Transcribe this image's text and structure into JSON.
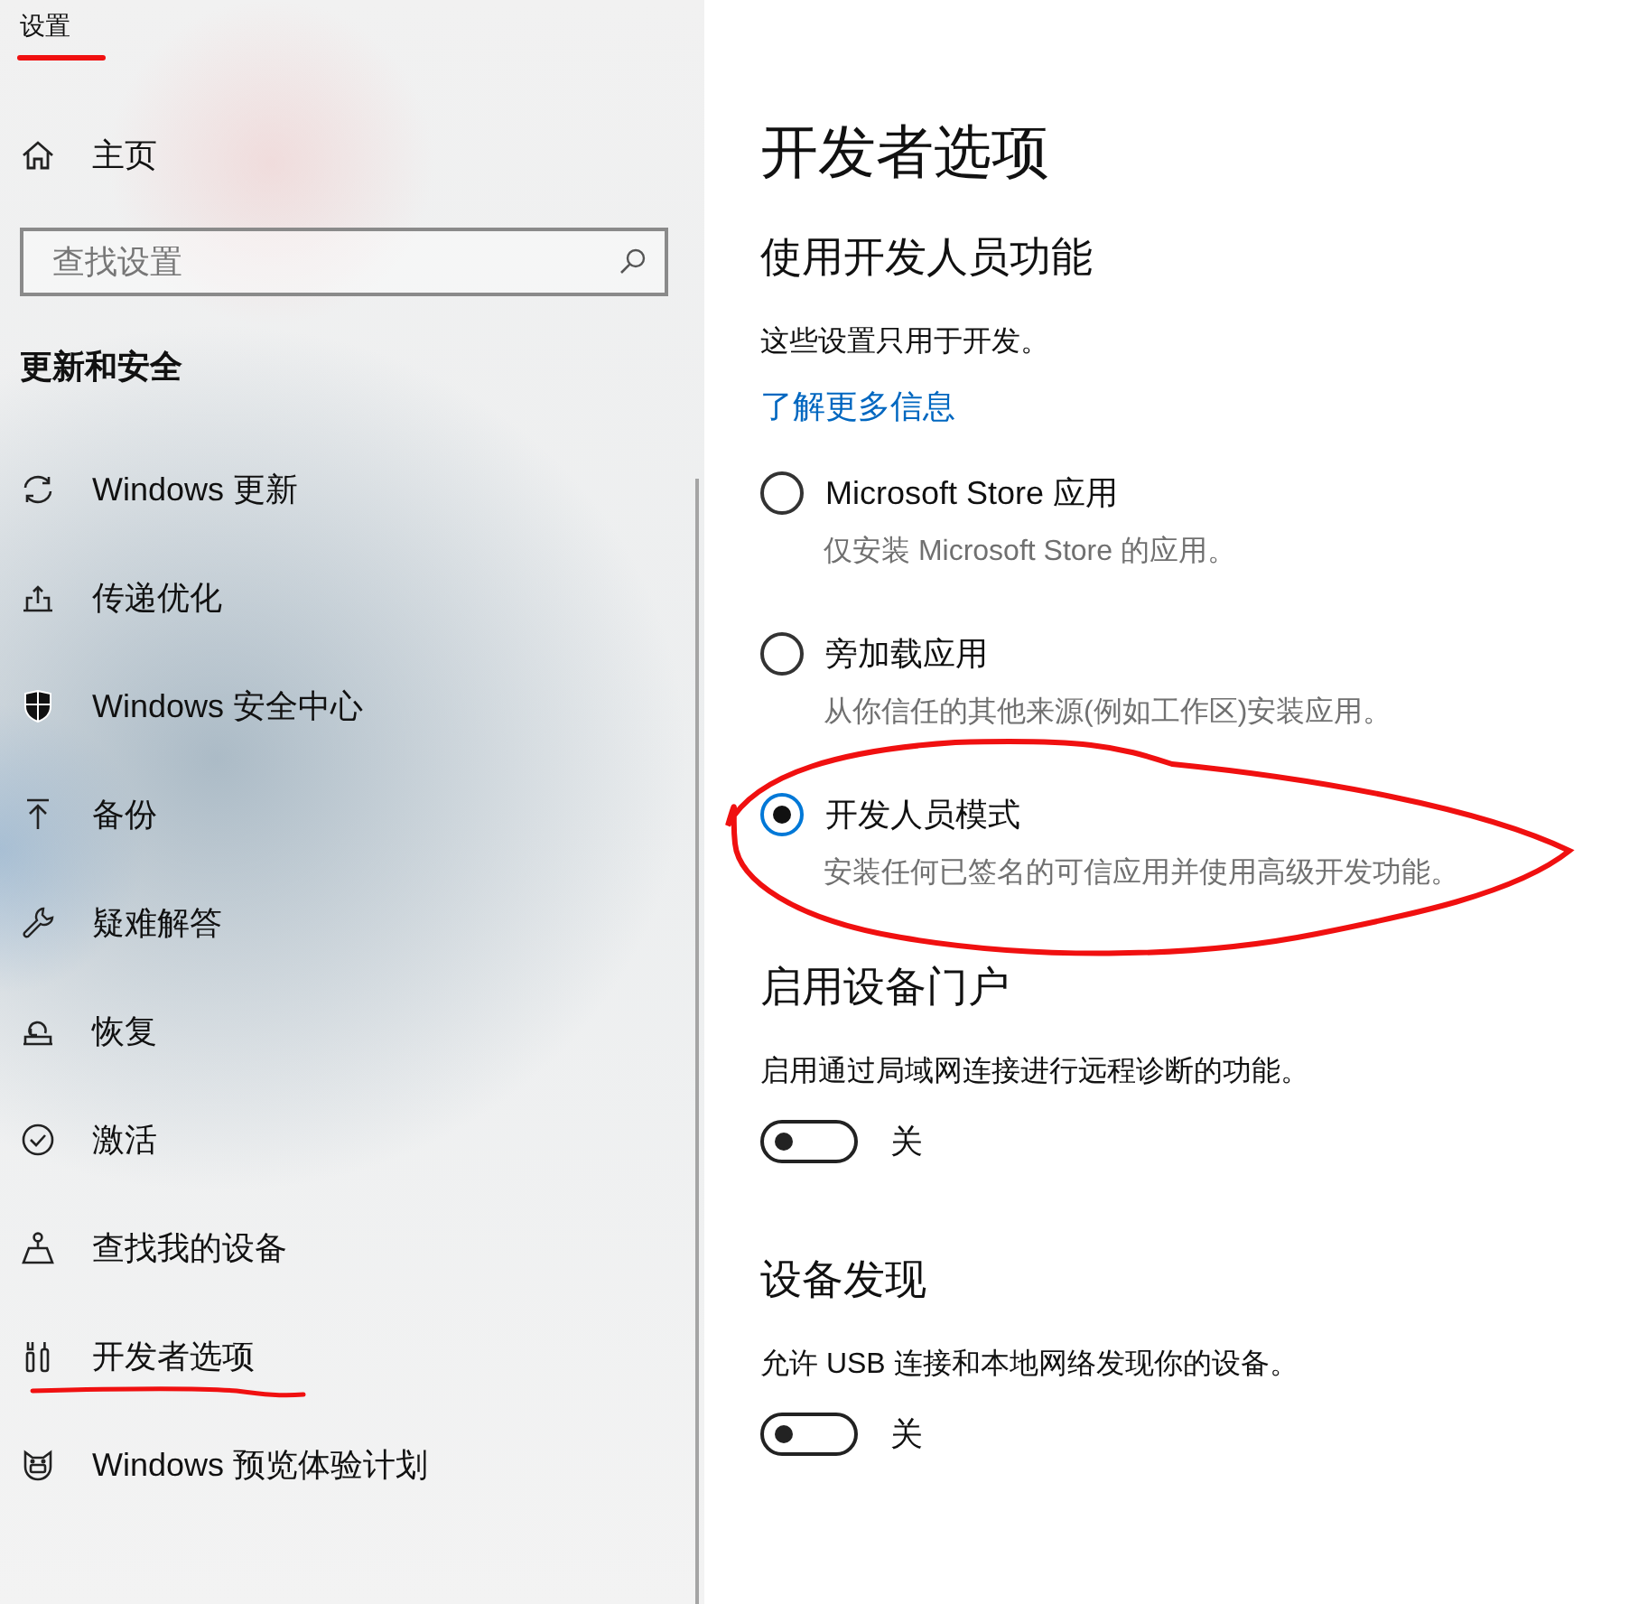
{
  "window": {
    "title": "设置",
    "annotated": true
  },
  "sidebar": {
    "home": {
      "label": "主页"
    },
    "search": {
      "placeholder": "查找设置"
    },
    "section_title": "更新和安全",
    "items": [
      {
        "label": "Windows 更新",
        "selected": false,
        "annotated": false
      },
      {
        "label": "传递优化",
        "selected": false,
        "annotated": false
      },
      {
        "label": "Windows 安全中心",
        "selected": false,
        "annotated": false
      },
      {
        "label": "备份",
        "selected": false,
        "annotated": false
      },
      {
        "label": "疑难解答",
        "selected": false,
        "annotated": false
      },
      {
        "label": "恢复",
        "selected": false,
        "annotated": false
      },
      {
        "label": "激活",
        "selected": false,
        "annotated": false
      },
      {
        "label": "查找我的设备",
        "selected": false,
        "annotated": false
      },
      {
        "label": "开发者选项",
        "selected": false,
        "annotated": true
      },
      {
        "label": "Windows 预览体验计划",
        "selected": false,
        "annotated": false
      }
    ]
  },
  "page": {
    "title": "开发者选项",
    "heading": "使用开发人员功能",
    "intro": "这些设置只用于开发。",
    "link": "了解更多信息",
    "options": [
      {
        "label": "Microsoft Store 应用",
        "description": "仅安装 Microsoft Store 的应用。",
        "selected": false,
        "annotated": false
      },
      {
        "label": "旁加载应用",
        "description": "从你信任的其他来源(例如工作区)安装应用。",
        "selected": false,
        "annotated": false
      },
      {
        "label": "开发人员模式",
        "description": "安装任何已签名的可信应用并使用高级开发功能。",
        "selected": true,
        "annotated": true
      }
    ],
    "sections": [
      {
        "title": "启用设备门户",
        "description": "启用通过局域网连接进行远程诊断的功能。",
        "toggle": {
          "on": false,
          "label": "关"
        }
      },
      {
        "title": "设备发现",
        "description": "允许 USB 连接和本地网络发现你的设备。",
        "toggle": {
          "on": false,
          "label": "关"
        }
      }
    ]
  }
}
